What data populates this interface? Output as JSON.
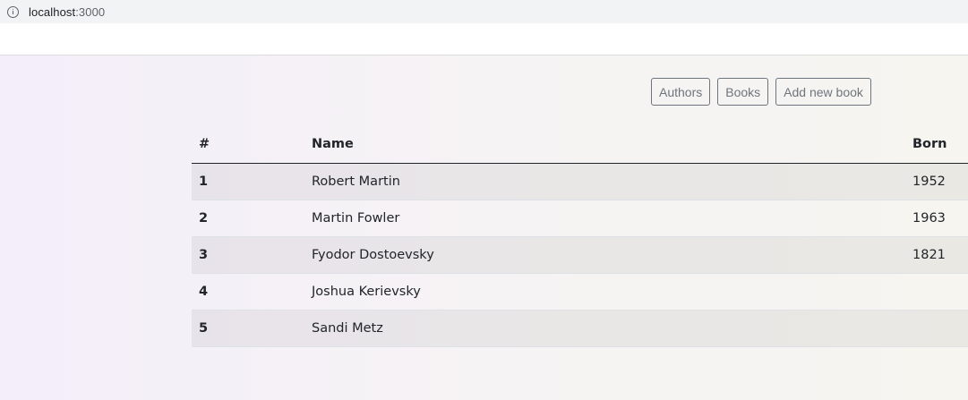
{
  "browser": {
    "url_host": "localhost",
    "url_port": ":3000"
  },
  "nav": {
    "authors_label": "Authors",
    "books_label": "Books",
    "add_book_label": "Add new book"
  },
  "table": {
    "headers": [
      "#",
      "Name",
      "Born"
    ],
    "rows": [
      {
        "num": "1",
        "name": "Robert Martin",
        "born": "1952"
      },
      {
        "num": "2",
        "name": "Martin Fowler",
        "born": "1963"
      },
      {
        "num": "3",
        "name": "Fyodor Dostoevsky",
        "born": "1821"
      },
      {
        "num": "4",
        "name": "Joshua Kerievsky",
        "born": ""
      },
      {
        "num": "5",
        "name": "Sandi Metz",
        "born": ""
      }
    ]
  },
  "icons": {
    "address_bar": "info-icon"
  }
}
